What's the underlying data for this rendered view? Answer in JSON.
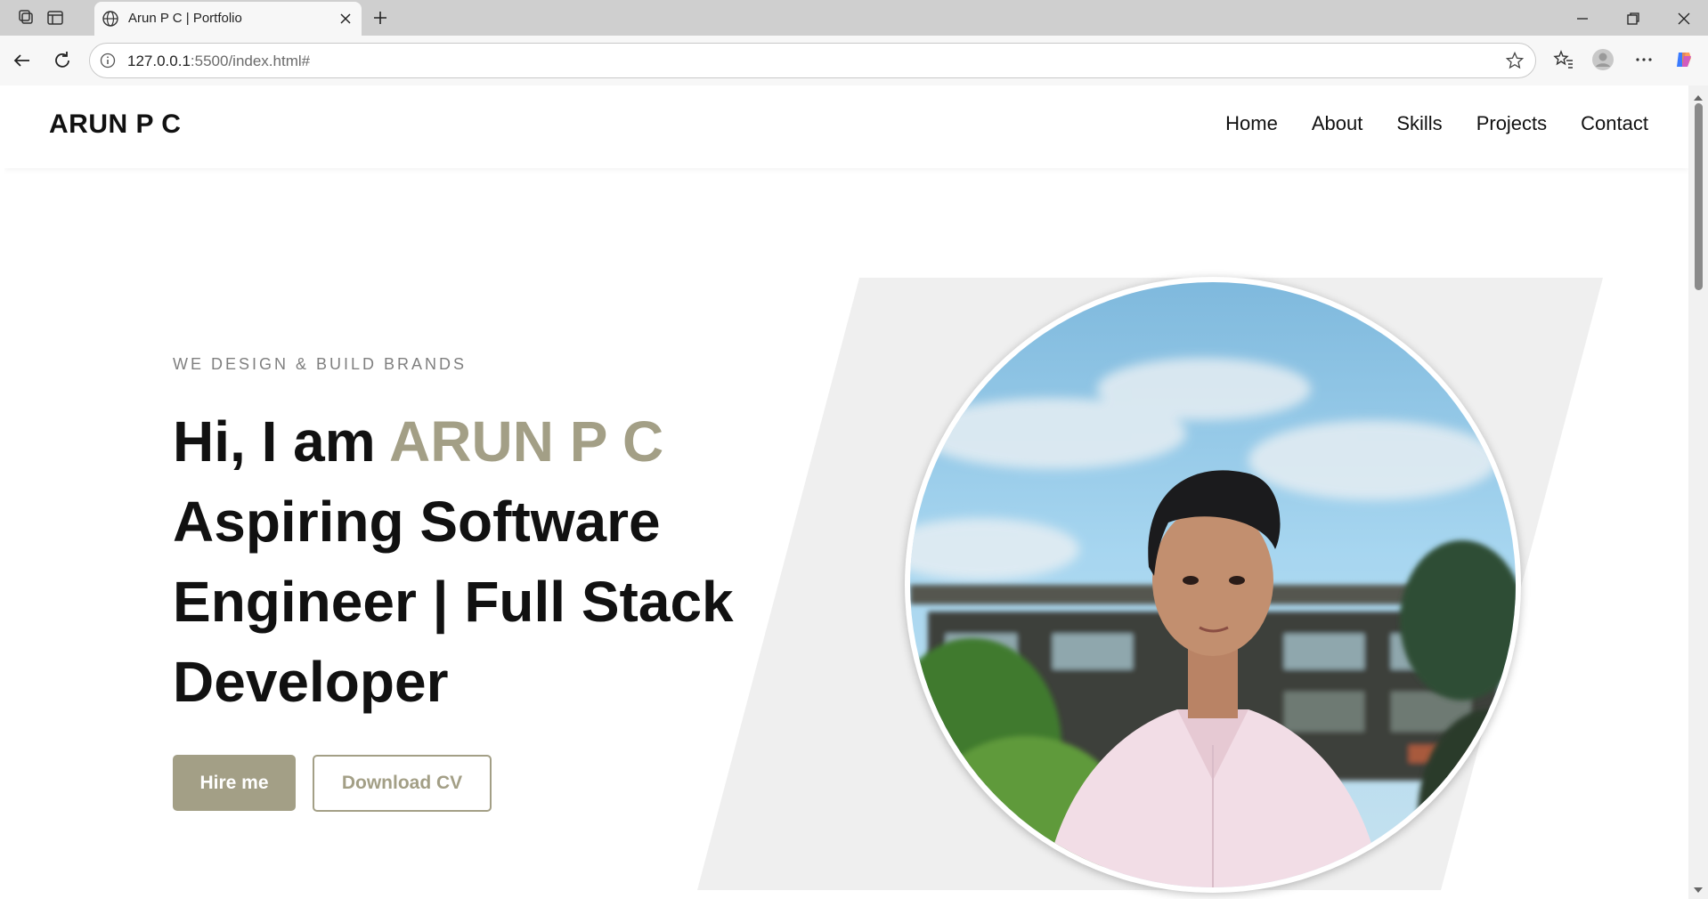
{
  "browser": {
    "tab_title": "Arun P C | Portfolio",
    "url_host": "127.0.0.1",
    "url_rest": ":5500/index.html#"
  },
  "site": {
    "logo": "ARUN P C",
    "nav": [
      "Home",
      "About",
      "Skills",
      "Projects",
      "Contact"
    ]
  },
  "hero": {
    "subtitle": "WE DESIGN & BUILD BRANDS",
    "greeting": "Hi, I am ",
    "name": "ARUN P C",
    "role": "Aspiring Software Engineer | Full Stack Developer",
    "hire_label": "Hire me",
    "cv_label": "Download CV"
  },
  "colors": {
    "accent": "#a39f86",
    "text": "#111111",
    "subtitle": "#7f7f7f",
    "backdrop": "#efefef"
  }
}
